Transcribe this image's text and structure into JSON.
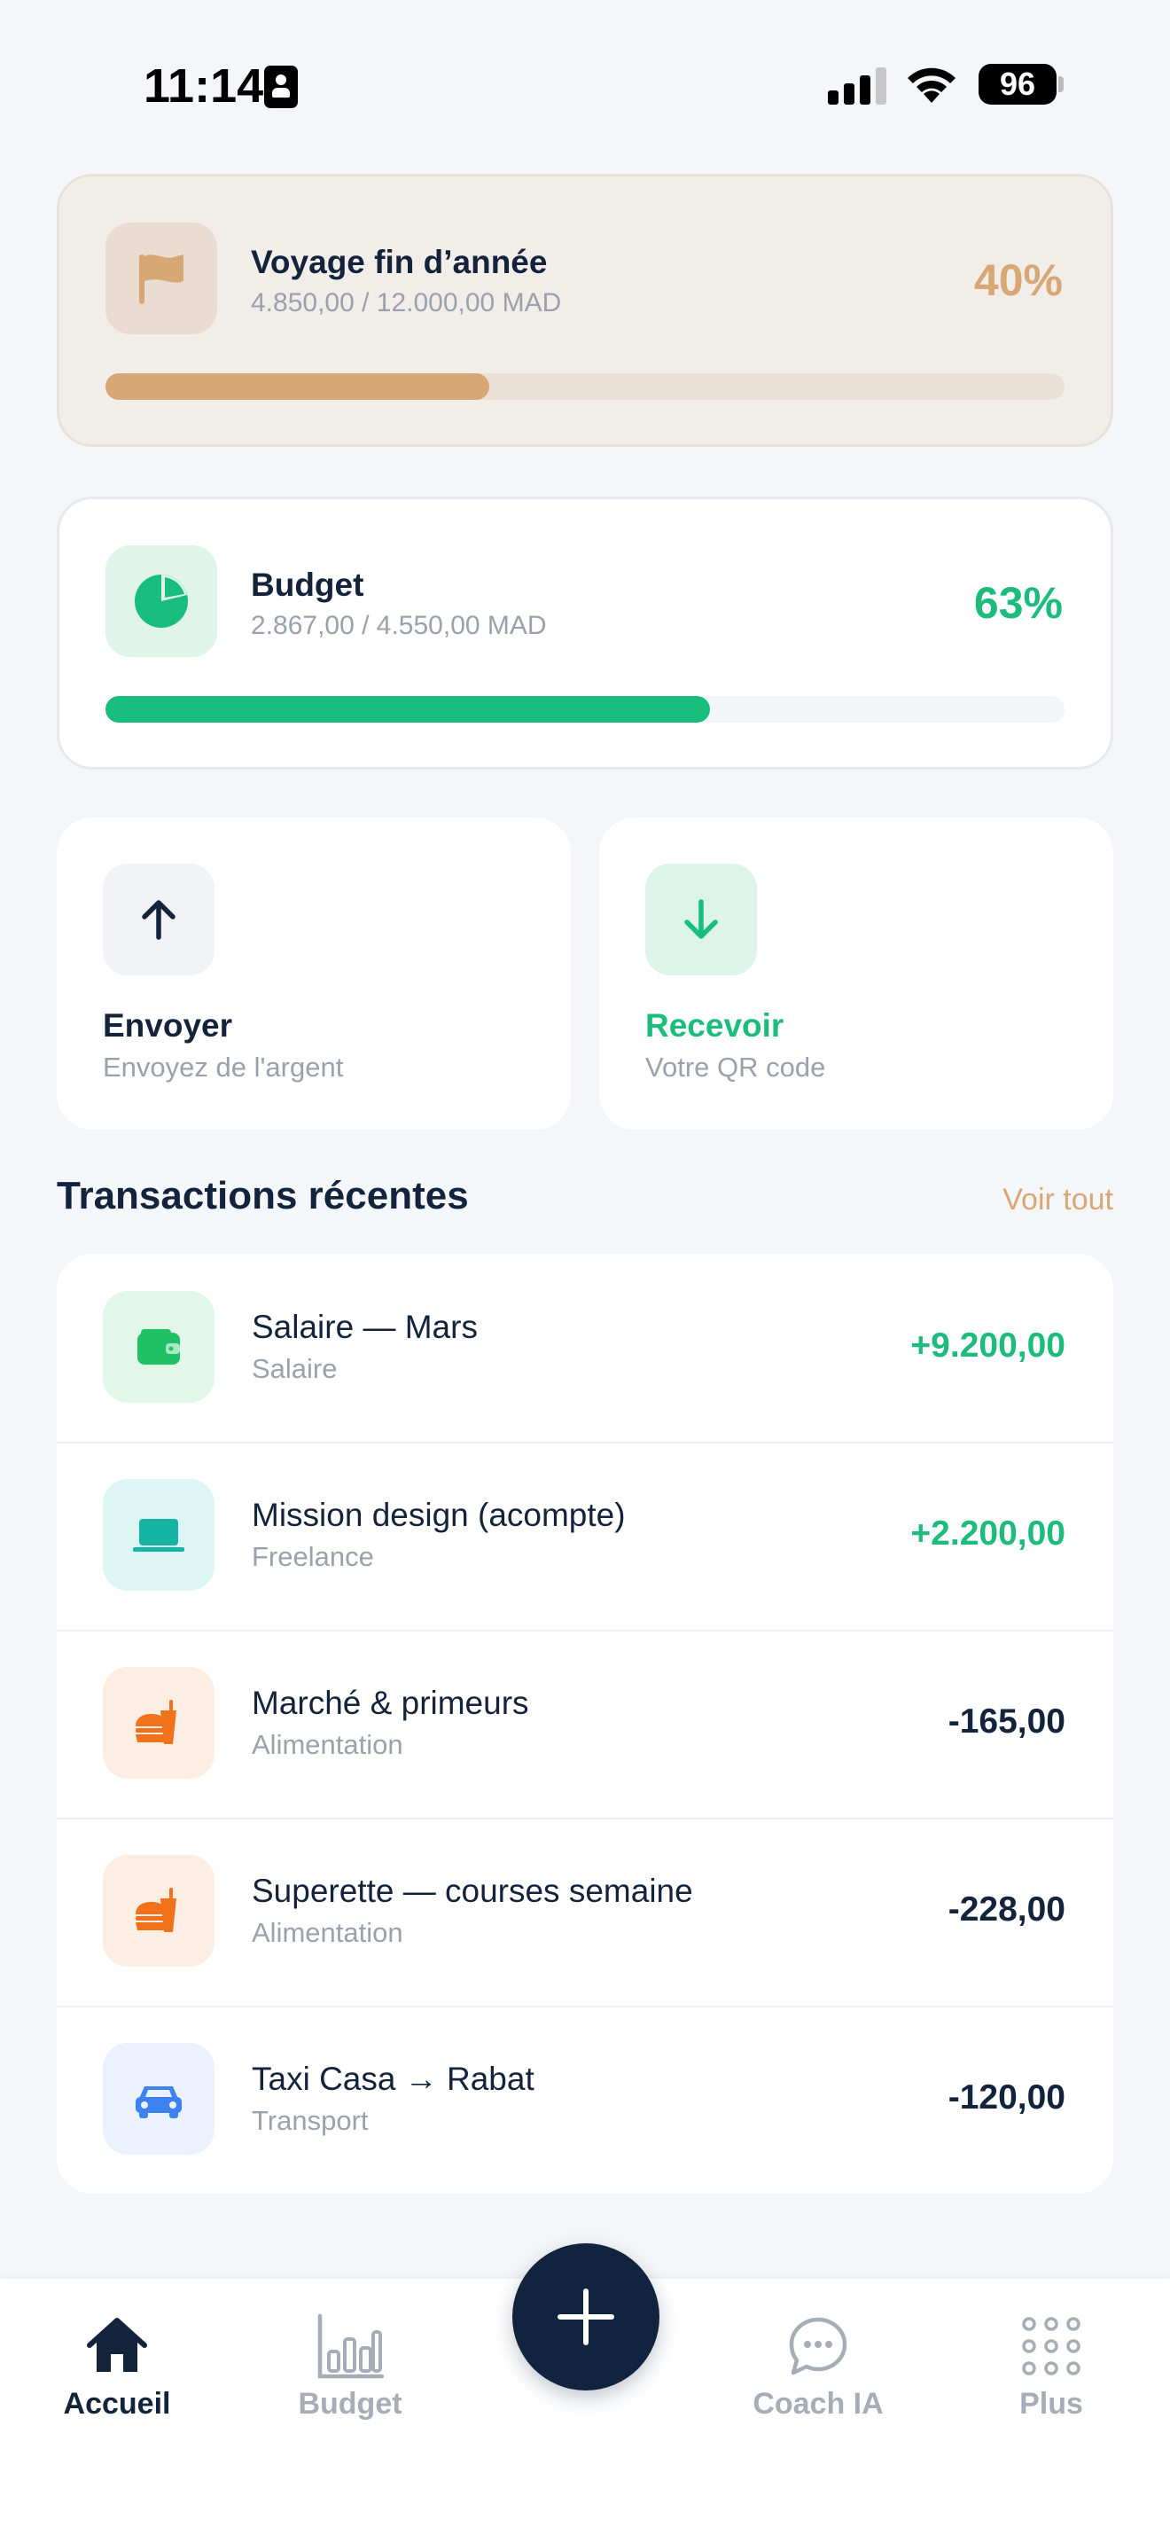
{
  "status_bar": {
    "time": "11:14",
    "battery": "96"
  },
  "goal_card": {
    "title": "Voyage fin d’année",
    "subtitle": "4.850,00 / 12.000,00 MAD",
    "percent_label": "40%",
    "progress": 0.4,
    "icon": "flag-icon",
    "color": "#d7a775"
  },
  "budget_card": {
    "title": "Budget",
    "subtitle": "2.867,00 / 4.550,00 MAD",
    "percent_label": "63%",
    "progress": 0.63,
    "icon": "pie-chart-icon",
    "color": "#19bd7e"
  },
  "actions": {
    "send": {
      "label": "Envoyer",
      "description": "Envoyez de l'argent",
      "icon": "arrow-up-icon"
    },
    "receive": {
      "label": "Recevoir",
      "description": "Votre QR code",
      "icon": "arrow-down-icon"
    }
  },
  "transactions": {
    "title": "Transactions récentes",
    "see_all": "Voir tout",
    "items": [
      {
        "name": "Salaire — Mars",
        "category": "Salaire",
        "amount": "+9.200,00",
        "icon": "wallet-icon",
        "type": "pos"
      },
      {
        "name": "Mission design (acompte)",
        "category": "Freelance",
        "amount": "+2.200,00",
        "icon": "laptop-icon",
        "type": "pos"
      },
      {
        "name": "Marché & primeurs",
        "category": "Alimentation",
        "amount": "-165,00",
        "icon": "food-icon",
        "type": "neg"
      },
      {
        "name": "Superette — courses semaine",
        "category": "Alimentation",
        "amount": "-228,00",
        "icon": "food-icon",
        "type": "neg"
      },
      {
        "name": "Taxi Casa → Rabat",
        "category": "Transport",
        "amount": "-120,00",
        "icon": "car-icon",
        "type": "neg"
      }
    ]
  },
  "nav": {
    "home": "Accueil",
    "budget": "Budget",
    "coach": "Coach IA",
    "more": "Plus",
    "add_icon": "plus-icon"
  }
}
